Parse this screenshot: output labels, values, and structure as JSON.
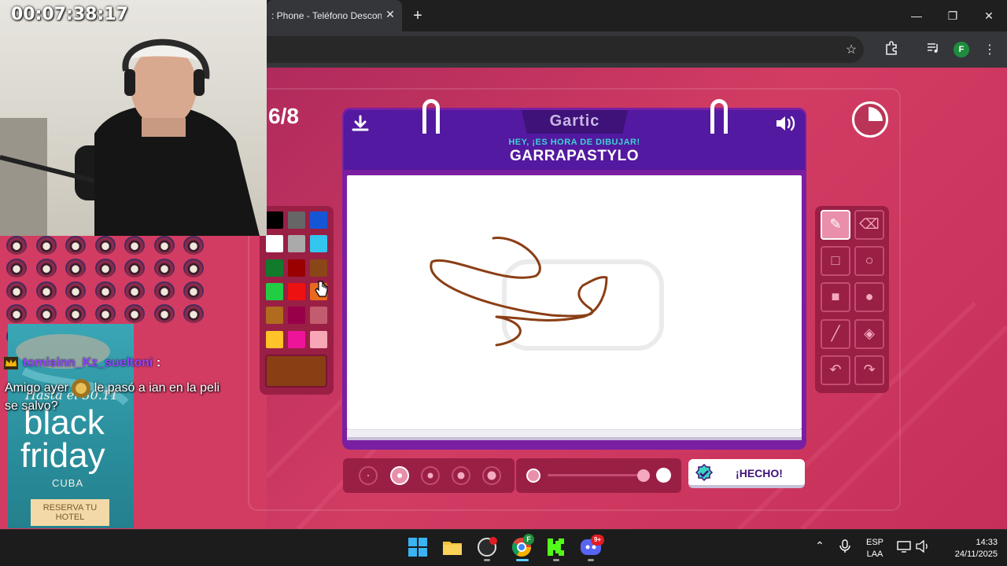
{
  "browser": {
    "tab_title": ": Phone - Teléfono Desconectado",
    "tab_close_glyph": "✕",
    "new_tab_glyph": "+",
    "profile_initial": "F",
    "window_controls": [
      "—",
      "❐",
      "✕"
    ]
  },
  "game": {
    "round": "6/8",
    "logo": "Gartic",
    "prompt_subtitle": "HEY, ¡ES HORA DE DIBUJAR!",
    "word": "GARRAPASTYLO",
    "done_label": "¡HECHO!",
    "palette": [
      [
        "#000000",
        "#666666",
        "#1556d6"
      ],
      [
        "#ffffff",
        "#aaaaaa",
        "#33c6ef"
      ],
      [
        "#117a2b",
        "#990000",
        "#8a4617"
      ],
      [
        "#22cc44",
        "#ee1111",
        "#e9691e"
      ],
      [
        "#b06b1f",
        "#99004a",
        "#c45c6f"
      ],
      [
        "#ffc228",
        "#ee1499",
        "#f7a6b5"
      ]
    ],
    "selected_color": "#8a3e14",
    "tools": [
      [
        "pencil-icon",
        "eraser-icon"
      ],
      [
        "square-outline-icon",
        "circle-outline-icon"
      ],
      [
        "square-filled-icon",
        "circle-filled-icon"
      ],
      [
        "line-icon",
        "fill-bucket-icon"
      ],
      [
        "undo-icon",
        "redo-icon"
      ]
    ],
    "active_tool": "pencil-icon",
    "brush_sizes": 5,
    "active_brush_size_index": 1,
    "opacity_level": 1.0
  },
  "overlay": {
    "stream_timer": "00:07:38:17",
    "chat_user": "tomisinn_Kz_sueltoni",
    "chat_colon": ":",
    "chat_message_part1": "Amigo ayer",
    "chat_message_part2": "le pasó a ian en la peli se salvo?",
    "ad_script": "Hasta el 30.11",
    "ad_black": "black",
    "ad_friday": "friday",
    "ad_country": "CUBA",
    "ad_button": "RESERVA TU HOTEL"
  },
  "taskbar": {
    "lang_top": "ESP",
    "lang_bottom": "LAA",
    "time": "14:33",
    "date": "24/11/2025",
    "chrome_badge": "F",
    "discord_badge": "9+"
  }
}
